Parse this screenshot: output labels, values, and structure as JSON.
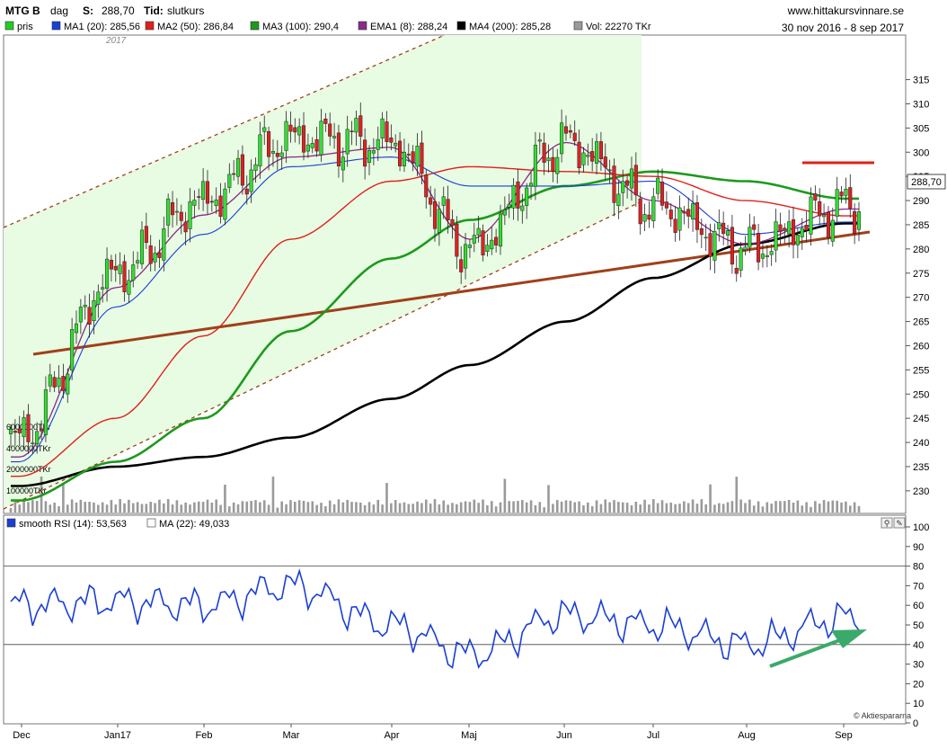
{
  "header": {
    "ticker": "MTG B",
    "period": "dag",
    "s_label": "S:",
    "s_value": "288,70",
    "tid_label": "Tid:",
    "tid_value": "slutkurs",
    "site": "www.hittakursvinnare.se",
    "date_range": "30 nov 2016 - 8 sep 2017"
  },
  "legend": [
    {
      "label": "pris",
      "color": "#22cc22"
    },
    {
      "label": "MA1 (20): 285,56",
      "color": "#1a3fd6"
    },
    {
      "label": "MA2 (50): 286,84",
      "color": "#e0201a"
    },
    {
      "label": "MA3 (100): 290,4",
      "color": "#1d9a1d"
    },
    {
      "label": "EMA1 (8): 288,24",
      "color": "#8a2a8a"
    },
    {
      "label": "MA4 (200): 285,28",
      "color": "#000000"
    },
    {
      "label": "Vol: 22270 TKr",
      "color": "#999999"
    }
  ],
  "year_label": "2017",
  "last_price_label": "288,70",
  "volume_labels": [
    "6000000TKr",
    "4000000TKr",
    "2000000TKr",
    "100000TKr"
  ],
  "rsi": {
    "legend": [
      {
        "label": "smooth RSI (14): 53,563",
        "color": "#1a3fd6"
      },
      {
        "label": "MA (22): 49,033",
        "color": "#ffffff"
      }
    ],
    "ticks": [
      "100",
      "90",
      "80",
      "70",
      "60",
      "50",
      "40",
      "30",
      "20",
      "10",
      "0"
    ],
    "guides": [
      80,
      40
    ]
  },
  "watermark": "© Aktiespararna",
  "colors": {
    "up": "#33dd33",
    "down": "#dd2222",
    "ma20": "#1a3fd6",
    "ma50": "#e0201a",
    "ma100": "#1d9a1d",
    "ema8": "#8a2a8a",
    "ma200": "#000000",
    "trend": "#a0401a",
    "rsi": "#1a3fd6",
    "arrow": "#3aaa6a"
  },
  "chart_data": {
    "type": "candlestick",
    "x_axis": {
      "months": [
        "Dec",
        "Jan17",
        "Feb",
        "Mar",
        "Apr",
        "Maj",
        "Jun",
        "Jul",
        "Aug",
        "Sep"
      ]
    },
    "y_axis": {
      "ticks": [
        230,
        235,
        240,
        245,
        250,
        255,
        260,
        265,
        270,
        275,
        280,
        285,
        290,
        295,
        300,
        305,
        310,
        315
      ],
      "range": [
        226,
        317
      ]
    },
    "series": [
      {
        "name": "pris",
        "values": [
          {
            "date": "Dec",
            "close": 241
          },
          {
            "date": "Jan17",
            "close": 275
          },
          {
            "date": "Feb",
            "close": 290
          },
          {
            "date": "Mar",
            "close": 303
          },
          {
            "date": "Apr",
            "close": 302
          },
          {
            "date": "Maj",
            "close": 280
          },
          {
            "date": "Jun",
            "close": 302
          },
          {
            "date": "Jul",
            "close": 289
          },
          {
            "date": "Aug",
            "close": 280
          },
          {
            "date": "Sep",
            "close": 288.7
          }
        ]
      },
      {
        "name": "MA1 (20): 285,56",
        "values": [
          {
            "date": "Dec",
            "close": 236
          },
          {
            "date": "Jan17",
            "close": 268
          },
          {
            "date": "Feb",
            "close": 283
          },
          {
            "date": "Mar",
            "close": 297
          },
          {
            "date": "Apr",
            "close": 299
          },
          {
            "date": "Maj",
            "close": 293
          },
          {
            "date": "Jun",
            "close": 293
          },
          {
            "date": "Jul",
            "close": 294
          },
          {
            "date": "Aug",
            "close": 283
          },
          {
            "date": "Sep",
            "close": 285.56
          }
        ]
      },
      {
        "name": "MA2 (50): 286,84",
        "values": [
          {
            "date": "Dec",
            "close": 233
          },
          {
            "date": "Jan17",
            "close": 245
          },
          {
            "date": "Feb",
            "close": 262
          },
          {
            "date": "Mar",
            "close": 282
          },
          {
            "date": "Apr",
            "close": 294
          },
          {
            "date": "Maj",
            "close": 297
          },
          {
            "date": "Jun",
            "close": 296
          },
          {
            "date": "Jul",
            "close": 295
          },
          {
            "date": "Aug",
            "close": 290
          },
          {
            "date": "Sep",
            "close": 286.84
          }
        ]
      },
      {
        "name": "MA3 (100): 290,4",
        "values": [
          {
            "date": "Dec",
            "close": 228
          },
          {
            "date": "Jan17",
            "close": 236
          },
          {
            "date": "Feb",
            "close": 245
          },
          {
            "date": "Mar",
            "close": 263
          },
          {
            "date": "Apr",
            "close": 278
          },
          {
            "date": "Maj",
            "close": 286
          },
          {
            "date": "Jun",
            "close": 293
          },
          {
            "date": "Jul",
            "close": 296
          },
          {
            "date": "Aug",
            "close": 294
          },
          {
            "date": "Sep",
            "close": 290.4
          }
        ]
      },
      {
        "name": "EMA1 (8): 288,24",
        "values": [
          {
            "date": "Dec",
            "close": 237
          },
          {
            "date": "Jan17",
            "close": 272
          },
          {
            "date": "Feb",
            "close": 287
          },
          {
            "date": "Mar",
            "close": 299
          },
          {
            "date": "Apr",
            "close": 301
          },
          {
            "date": "Maj",
            "close": 282
          },
          {
            "date": "Jun",
            "close": 302
          },
          {
            "date": "Jul",
            "close": 290
          },
          {
            "date": "Aug",
            "close": 281
          },
          {
            "date": "Sep",
            "close": 288.24
          }
        ]
      },
      {
        "name": "MA4 (200): 285,28",
        "values": [
          {
            "date": "Dec",
            "close": 231
          },
          {
            "date": "Jan17",
            "close": 235
          },
          {
            "date": "Feb",
            "close": 237
          },
          {
            "date": "Mar",
            "close": 241
          },
          {
            "date": "Apr",
            "close": 249
          },
          {
            "date": "Maj",
            "close": 256
          },
          {
            "date": "Jun",
            "close": 265
          },
          {
            "date": "Jul",
            "close": 274
          },
          {
            "date": "Aug",
            "close": 281
          },
          {
            "date": "Sep",
            "close": 285.28
          }
        ]
      },
      {
        "name": "smooth RSI (14): 53,563",
        "values": [
          {
            "date": "Dec",
            "value": 60
          },
          {
            "date": "Jan17",
            "value": 62
          },
          {
            "date": "Feb",
            "value": 60
          },
          {
            "date": "Mar",
            "value": 70
          },
          {
            "date": "Apr",
            "value": 50
          },
          {
            "date": "Maj",
            "value": 35
          },
          {
            "date": "Jun",
            "value": 55
          },
          {
            "date": "Jul",
            "value": 50
          },
          {
            "date": "Aug",
            "value": 40
          },
          {
            "date": "Sep",
            "value": 53.563
          }
        ]
      }
    ],
    "rsi_axis": {
      "ticks": [
        0,
        10,
        20,
        30,
        40,
        50,
        60,
        70,
        80,
        90,
        100
      ],
      "range": [
        0,
        100
      ]
    },
    "grid": false
  }
}
